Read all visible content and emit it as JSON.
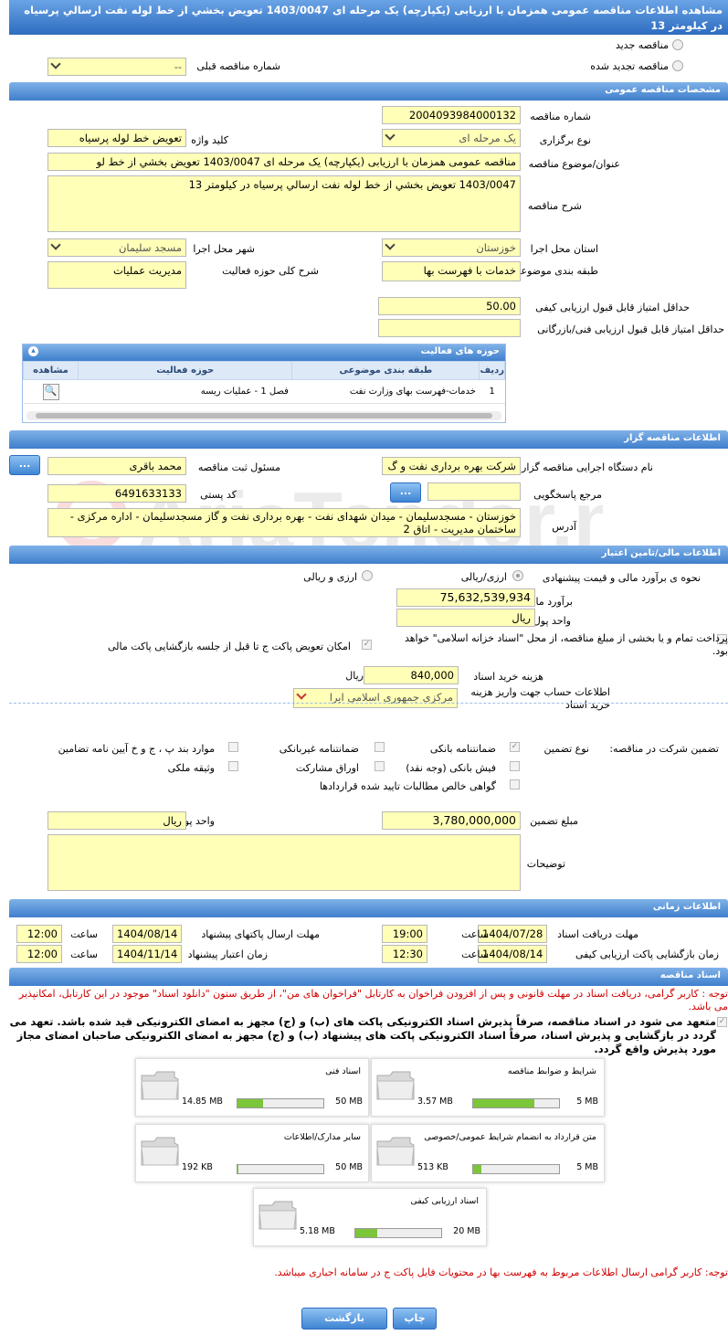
{
  "title": "مشاهده اطلاعات مناقصه عمومی همزمان با ارزیابی (یکپارچه) یک مرحله ای 1403/0047 تعویض بخشي از خط لوله نفت ارسالي پرسیاه در کیلومتر 13",
  "tender_type": {
    "new": "مناقصه جدید",
    "renewed": "مناقصه تجدید شده",
    "prev_no_label": "شماره مناقصه قبلی",
    "prev_no_value": "--"
  },
  "general": {
    "header": "مشخصات مناقصه عمومی",
    "number_label": "شماره مناقصه",
    "number": "2004093984000132",
    "type_label": "نوع برگزاری",
    "type": "یک مرحله ای",
    "keyword_label": "کلید واژه",
    "keyword": "تعویض خط لوله پرسیاه",
    "subject_label": "عنوان/موضوع مناقصه",
    "subject": "مناقصه عمومی همزمان با ارزیابی (یکپارچه) یک مرحله ای 1403/0047 تعویض بخشي از خط لو",
    "desc_label": "شرح مناقصه",
    "desc": "1403/0047 تعویض بخشي از خط لوله نفت ارسالي پرسیاه در کیلومتر 13",
    "province_label": "استان محل اجرا",
    "province": "خوزستان",
    "city_label": "شهر محل اجرا",
    "city": "مسجد سلیمان",
    "category_label": "طبقه بندی موضوعی",
    "category": "خدمات با فهرست بها",
    "scope_label": "شرح کلی حوزه فعالیت",
    "scope": "مدیریت عملیات",
    "min_quality_label": "حداقل امتیاز قابل قبول ارزیابی کیفی",
    "min_quality": "50.00",
    "min_tech_label": "حداقل امتیاز قابل قبول ارزیابی فنی/بازرگانی",
    "min_tech": ""
  },
  "activity": {
    "header": "حوزه های فعالیت",
    "cols": [
      "ردیف",
      "طبقه بندی موضوعی",
      "حوزه فعالیت",
      "مشاهده"
    ],
    "rows": [
      {
        "idx": "1",
        "cat": "خدمات-فهرست بهای وزارت نفت",
        "field": "فصل 1 - عملیات ریسه"
      }
    ]
  },
  "org": {
    "header": "اطلاعات مناقصه گزار",
    "name_label": "نام دستگاه اجرایی مناقصه گزار",
    "name": "شرکت بهره برداری نفت و گ",
    "resp_label": "مسئول ثبت مناقصه",
    "resp": "محمد باقری",
    "ref_label": "مرجع پاسخگویی",
    "ref": "",
    "postal_label": "کد پستی",
    "postal": "6491633133",
    "addr_label": "آدرس",
    "addr": "خوزستان - مسجدسلیمان - میدان شهدای نفت - بهره برداری نفت و گاز مسجدسلیمان - اداره مرکزی - ساختمان مدیریت - اتاق 2",
    "btn": "..."
  },
  "finance": {
    "header": "اطلاعات مالی/تامین اعتبار",
    "est_label": "نحوه ی برآورد مالی و قیمت پیشنهادی",
    "opt1": "ارزی/ریالی",
    "opt2": "ارزی و ریالی",
    "est_amount_label": "برآورد مالی",
    "est_amount": "75,632,539,934",
    "currency_label": "واحد پول",
    "currency": "ریال",
    "pay_label": "پرداخت تمام و یا بخشی از مبلغ مناقصه، از محل \"اسناد خزانه اسلامی\" خواهد بود.",
    "exchange_label": "امکان تعویض پاکت ج تا قبل از جلسه بازگشایی پاکت مالی",
    "doc_cost_label": "هزینه خرید اسناد",
    "doc_cost": "840,000",
    "doc_cost_unit": "ریال",
    "account_label": "اطلاعات حساب جهت واریز هزینه خرید اسناد",
    "account": "مرکزی جمهوری اسلامی ایرا"
  },
  "guarantee": {
    "label": "تضمین شرکت در مناقصه:",
    "type_label": "نوع تضمین",
    "items": [
      "ضمانتنامه بانکی",
      "ضمانتنامه غیربانکی",
      "موارد بند پ ، ج و خ آیین نامه تضامین",
      "فیش بانکی (وجه نقد)",
      "اوراق مشارکت",
      "وثیقه ملکی",
      "گواهی خالص مطالبات تایید شده قراردادها"
    ],
    "amount_label": "مبلغ تضمین",
    "amount": "3,780,000,000",
    "unit_label": "واحد پول",
    "unit": "ریال",
    "notes_label": "توضیحات",
    "notes": ""
  },
  "timing": {
    "header": "اطلاعات زمانی",
    "recv_label": "مهلت دریافت اسناد",
    "recv_date": "1404/07/28",
    "recv_time": "19:00",
    "send_label": "مهلت ارسال پاکتهای پیشنهاد",
    "send_date": "1404/08/14",
    "send_time": "12:00",
    "open_label": "زمان بازگشایی پاکت ارزیابی کیفی",
    "open_date": "1404/08/14",
    "open_time": "12:30",
    "valid_label": "زمان اعتبار پیشنهاد",
    "valid_date": "1404/11/14",
    "valid_time": "12:00",
    "time_label": "ساعت"
  },
  "docs": {
    "header": "اسناد مناقصه",
    "note1": "توجه : کاربر گرامی، دریافت اسناد در مهلت قانونی و پس از افزودن فراخوان به کارتابل \"فراخوان های من\"، از طریق ستون \"دانلود اسناد\" موجود در این کارتابل، امکانپذیر می باشد.",
    "commit": "متعهد می شود در اسناد مناقصه، صرفاً پذیرش اسناد الکترونیکی پاکت های (ب) و (ج) مجهز به امضای الکترونیکی قید شده باشد. تعهد می گردد در بازگشایی و پذیرش اسناد، صرفاً اسناد الکترونیکی پاکت های پیشنهاد (ب) و (ج) مجهز به امضای الکترونیکی صاحبان امضای مجاز مورد پذیرش واقع گردد.",
    "cards": [
      {
        "title": "شرایط و ضوابط مناقصه",
        "max": "5 MB",
        "cur": "3.57 MB",
        "fill": 0.714
      },
      {
        "title": "اسناد فنی",
        "max": "50 MB",
        "cur": "14.85 MB",
        "fill": 0.297
      },
      {
        "title": "متن قرارداد به انضمام شرایط عمومی/خصوصی",
        "max": "5 MB",
        "cur": "513 KB",
        "fill": 0.1
      },
      {
        "title": "سایر مدارک/اطلاعات",
        "max": "50 MB",
        "cur": "192 KB",
        "fill": 0.004
      },
      {
        "title": "اسناد ارزیابی کیفی",
        "max": "20 MB",
        "cur": "5.18 MB",
        "fill": 0.259
      }
    ],
    "note2": "توجه: کاربر گرامی ارسال اطلاعات مربوط به فهرست بها در محتویات فایل پاکت ج در سامانه اجباری میباشد."
  },
  "buttons": {
    "print": "چاپ",
    "back": "بازگشت"
  },
  "watermark": "AriaTender.net"
}
